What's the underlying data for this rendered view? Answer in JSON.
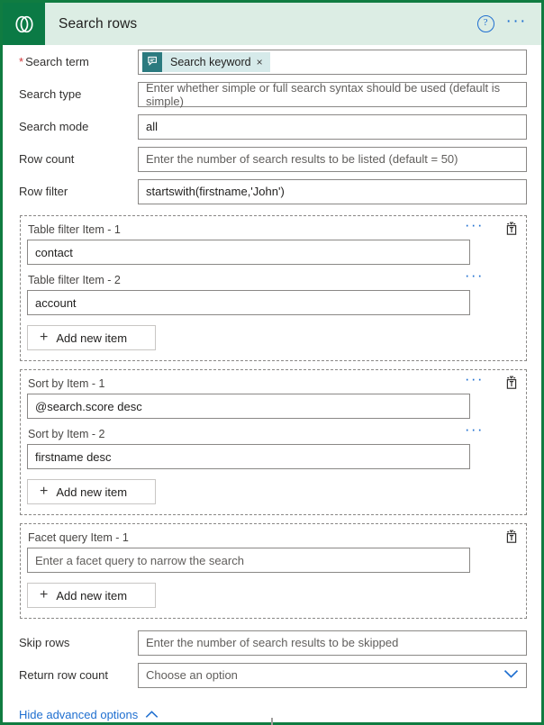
{
  "header": {
    "title": "Search rows",
    "logo_icon": "dataverse-logo-icon",
    "help_icon": "?",
    "help_icon_name": "help-icon",
    "overflow_icon": "···",
    "overflow_icon_name": "more-commands-icon",
    "band_color": "#dcede4",
    "logo_color": "#0b7a45",
    "border_color": "#107c41"
  },
  "fields": [
    {
      "label": "Search term",
      "required": true,
      "required_marker": "*",
      "type": "token",
      "token": {
        "icon_name": "dynamic-content-token-icon",
        "label": "Search keyword",
        "remove": "×",
        "chip_bg": "#d6eaea",
        "icon_bg": "#2b7a7f"
      }
    },
    {
      "label": "Search type",
      "required": false,
      "type": "text",
      "value": "",
      "placeholder": "Enter whether simple or full search syntax should be used (default is simple)"
    },
    {
      "label": "Search mode",
      "required": false,
      "type": "text",
      "value": "all",
      "placeholder": ""
    },
    {
      "label": "Row count",
      "required": false,
      "type": "text",
      "value": "",
      "placeholder": "Enter the number of search results to be listed (default = 50)"
    },
    {
      "label": "Row filter",
      "required": false,
      "type": "text",
      "value": "startswith(firstname,'John')",
      "placeholder": ""
    }
  ],
  "groups": [
    {
      "name": "table-filter",
      "add_label": "Add new item",
      "add_icon": "+",
      "trash_icon_name": "delete-icon",
      "items": [
        {
          "label": "Table filter Item - 1",
          "value": "contact",
          "placeholder": "",
          "has_menu": true,
          "menu_icon": "···"
        },
        {
          "label": "Table filter Item - 2",
          "value": "account",
          "placeholder": "",
          "has_menu": true,
          "menu_icon": "···"
        }
      ]
    },
    {
      "name": "sort-by",
      "add_label": "Add new item",
      "add_icon": "+",
      "trash_icon_name": "delete-icon",
      "items": [
        {
          "label": "Sort by Item - 1",
          "value": "@search.score desc",
          "placeholder": "",
          "has_menu": true,
          "menu_icon": "···"
        },
        {
          "label": "Sort by Item - 2",
          "value": "firstname desc",
          "placeholder": "",
          "has_menu": true,
          "menu_icon": "···"
        }
      ]
    },
    {
      "name": "facet-query",
      "add_label": "Add new item",
      "add_icon": "+",
      "trash_icon_name": "delete-icon",
      "items": [
        {
          "label": "Facet query Item - 1",
          "value": "",
          "placeholder": "Enter a facet query to narrow the search",
          "has_menu": false,
          "menu_icon": ""
        }
      ]
    }
  ],
  "tail_fields": [
    {
      "label": "Skip rows",
      "type": "text",
      "value": "",
      "placeholder": "Enter the number of search results to be skipped"
    },
    {
      "label": "Return row count",
      "type": "dropdown",
      "value": "",
      "placeholder": "Choose an option",
      "chevron": "∨",
      "chevron_icon_name": "chevron-down-icon"
    }
  ],
  "footer": {
    "advanced_toggle_label": "Hide advanced options",
    "advanced_toggle_chevron": "∧",
    "advanced_toggle_icon_name": "chevron-up-icon"
  }
}
